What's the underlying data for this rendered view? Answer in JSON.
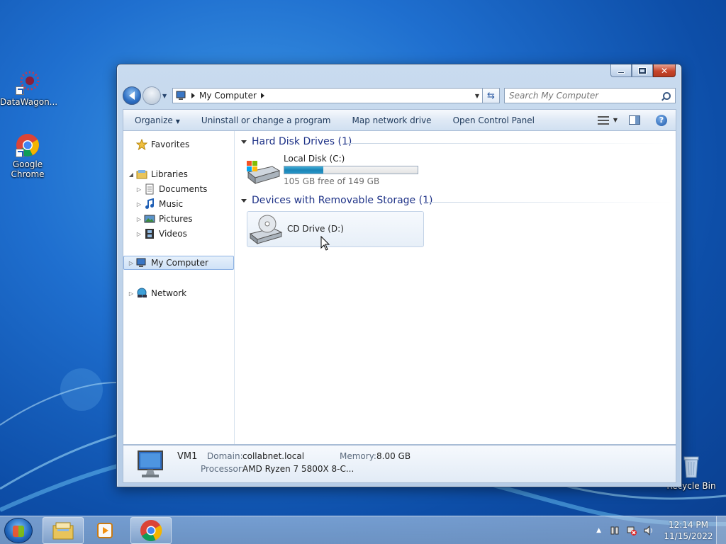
{
  "desktop": {
    "icons": [
      {
        "label": "DataWagon..."
      },
      {
        "label": "Google Chrome"
      },
      {
        "label": "Recycle Bin"
      }
    ]
  },
  "window": {
    "address": {
      "crumb": "My Computer"
    },
    "search": {
      "placeholder": "Search My Computer"
    },
    "toolbar": {
      "organize": "Organize",
      "uninstall": "Uninstall or change a program",
      "map_drive": "Map network drive",
      "control_panel": "Open Control Panel"
    },
    "nav": {
      "favorites": "Favorites",
      "libraries": "Libraries",
      "documents": "Documents",
      "music": "Music",
      "pictures": "Pictures",
      "videos": "Videos",
      "my_computer": "My Computer",
      "network": "Network"
    },
    "groups": {
      "hdd": {
        "title": "Hard Disk Drives (1)",
        "drive_name": "Local Disk (C:)",
        "free_text": "105 GB free of 149 GB",
        "used_fraction": 0.295
      },
      "removable": {
        "title": "Devices with Removable Storage (1)",
        "drive_name": "CD Drive (D:)"
      }
    },
    "details": {
      "name": "VM1",
      "domain_label": "Domain:",
      "domain_value": "collabnet.local",
      "memory_label": "Memory:",
      "memory_value": "8.00 GB",
      "processor_label": "Processor:",
      "processor_value": "AMD Ryzen 7 5800X 8-C..."
    }
  },
  "taskbar": {
    "time": "12:14 PM",
    "date": "11/15/2022"
  },
  "colors": {
    "accent": "#1e3287",
    "bar_fill": "#1b84b7",
    "close_button": "#c7452b"
  }
}
